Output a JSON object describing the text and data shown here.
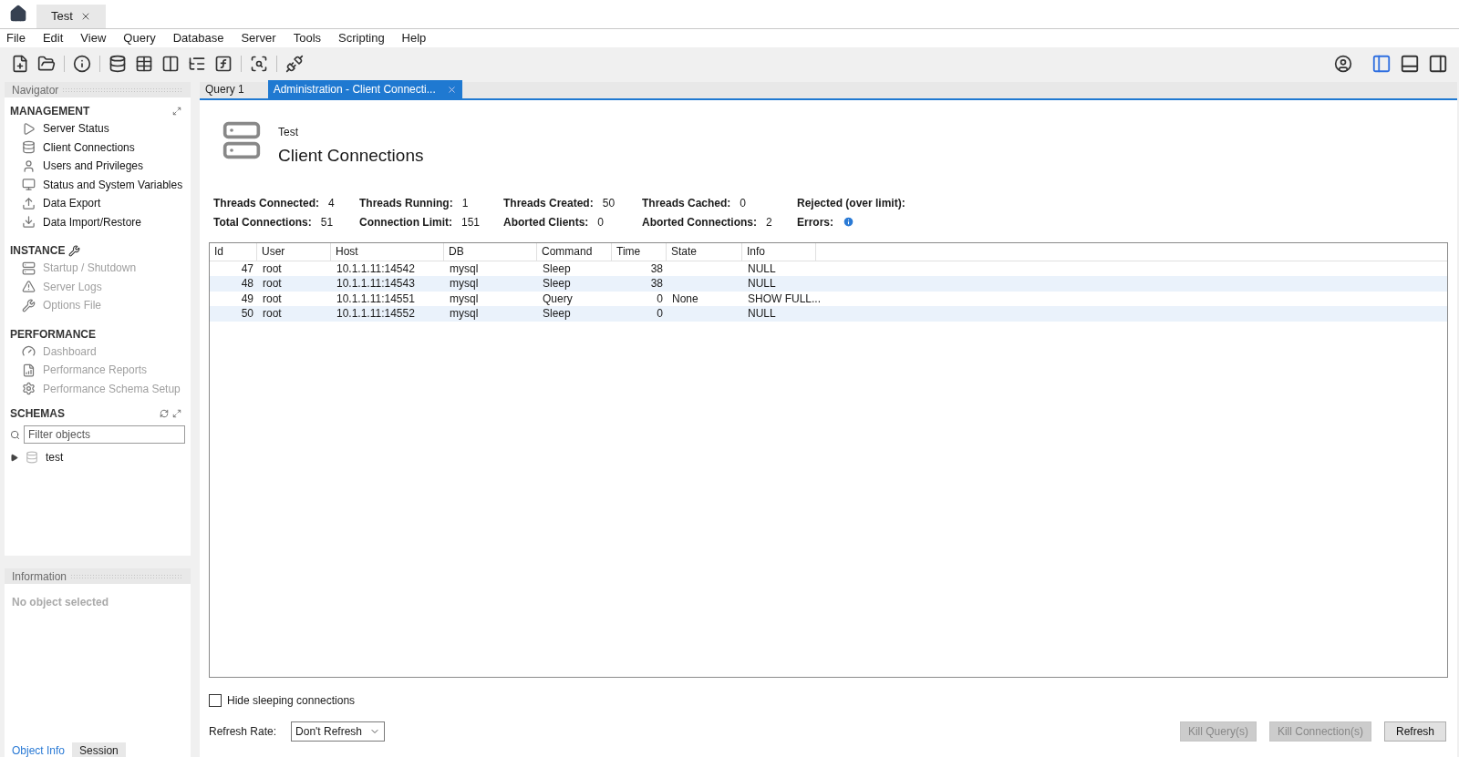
{
  "window_tabs": [
    {
      "label": "Test",
      "selected": true
    }
  ],
  "menu": [
    "File",
    "Edit",
    "View",
    "Query",
    "Database",
    "Server",
    "Tools",
    "Scripting",
    "Help"
  ],
  "navigator": {
    "title": "Navigator",
    "sections": [
      {
        "title": "MANAGEMENT",
        "items": [
          {
            "label": "Server Status",
            "disabled": false
          },
          {
            "label": "Client Connections",
            "disabled": false
          },
          {
            "label": "Users and Privileges",
            "disabled": false
          },
          {
            "label": "Status and System Variables",
            "disabled": false
          },
          {
            "label": "Data Export",
            "disabled": false
          },
          {
            "label": "Data Import/Restore",
            "disabled": false
          }
        ]
      },
      {
        "title": "INSTANCE",
        "items": [
          {
            "label": "Startup / Shutdown",
            "disabled": true
          },
          {
            "label": "Server Logs",
            "disabled": true
          },
          {
            "label": "Options File",
            "disabled": true
          }
        ]
      },
      {
        "title": "PERFORMANCE",
        "items": [
          {
            "label": "Dashboard",
            "disabled": true
          },
          {
            "label": "Performance Reports",
            "disabled": true
          },
          {
            "label": "Performance Schema Setup",
            "disabled": true
          }
        ]
      }
    ],
    "schemas": {
      "title": "SCHEMAS",
      "filter_placeholder": "Filter objects",
      "tree": [
        {
          "label": "test",
          "expanded": false
        }
      ]
    }
  },
  "information": {
    "title": "Information",
    "message": "No object selected",
    "tabs": [
      {
        "label": "Object Info",
        "selected": true
      },
      {
        "label": "Session",
        "selected": false
      }
    ]
  },
  "editor_tabs": [
    {
      "label": "Query 1",
      "selected": false
    },
    {
      "label": "Administration - Client Connecti...",
      "selected": true
    }
  ],
  "header": {
    "connection": "Test",
    "title": "Client Connections"
  },
  "stats": [
    {
      "label": "Threads Connected:",
      "value": "4",
      "kind": "text"
    },
    {
      "label": "Threads Running:",
      "value": "1",
      "kind": "text"
    },
    {
      "label": "Threads Created:",
      "value": "50",
      "kind": "text"
    },
    {
      "label": "Threads Cached:",
      "value": "0",
      "kind": "text"
    },
    {
      "label": "Rejected (over limit):",
      "kind": "text"
    },
    {
      "label": "Total Connections:",
      "value": "51",
      "kind": "text"
    },
    {
      "label": "Connection Limit:",
      "value": "151",
      "kind": "text"
    },
    {
      "label": "Aborted Clients:",
      "value": "0",
      "kind": "text"
    },
    {
      "label": "Aborted Connections:",
      "value": "2",
      "kind": "text"
    },
    {
      "label": "Errors:",
      "kind": "info"
    }
  ],
  "table": {
    "columns": [
      "Id",
      "User",
      "Host",
      "DB",
      "Command",
      "Time",
      "State",
      "Info"
    ],
    "rows": [
      [
        "47",
        "root",
        "10.1.1.11:14542",
        "mysql",
        "Sleep",
        "38",
        "",
        "NULL"
      ],
      [
        "48",
        "root",
        "10.1.1.11:14543",
        "mysql",
        "Sleep",
        "38",
        "",
        "NULL"
      ],
      [
        "49",
        "root",
        "10.1.1.11:14551",
        "mysql",
        "Query",
        "0",
        "None",
        "SHOW FULL..."
      ],
      [
        "50",
        "root",
        "10.1.1.11:14552",
        "mysql",
        "Sleep",
        "0",
        "",
        "NULL"
      ]
    ]
  },
  "hide_sleeping": {
    "label": "Hide sleeping connections",
    "checked": false
  },
  "refresh_rate": {
    "label": "Refresh Rate:",
    "value": "Don't Refresh"
  },
  "buttons": [
    {
      "label": "Kill Query(s)",
      "disabled": true
    },
    {
      "label": "Kill Connection(s)",
      "disabled": true
    },
    {
      "label": "Refresh",
      "disabled": false
    }
  ]
}
